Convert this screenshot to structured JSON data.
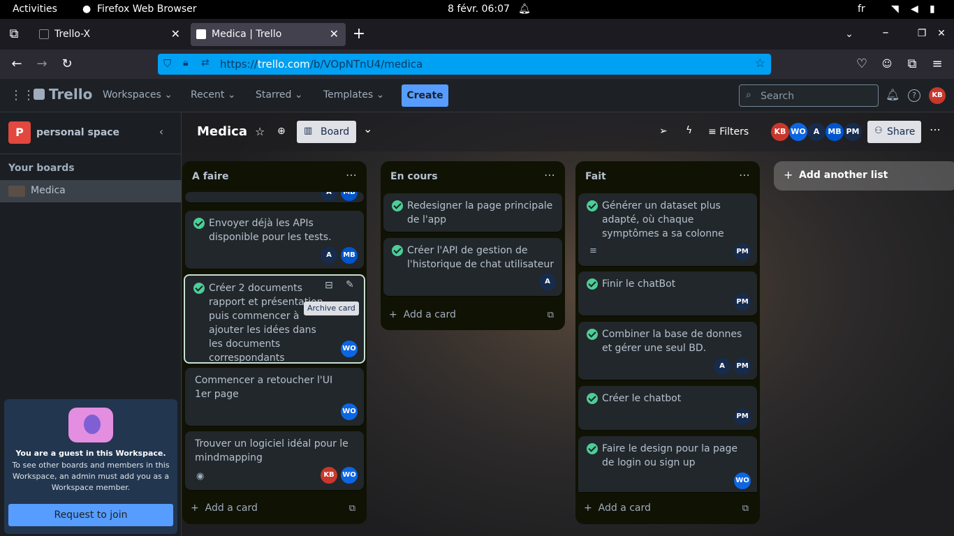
{
  "os": {
    "activities": "Activities",
    "app": "Firefox Web Browser",
    "clock": "8 févr.  06:07",
    "lang": "fr"
  },
  "browser": {
    "tabs": [
      {
        "label": "Trello-X"
      },
      {
        "label": "Medica | Trello"
      }
    ],
    "url_prefix": "https://",
    "url_domain": "trello.com",
    "url_path": "/b/VOpNTnU4/medica"
  },
  "header": {
    "logo": "Trello",
    "menus": [
      "Workspaces",
      "Recent",
      "Starred",
      "Templates"
    ],
    "create": "Create",
    "search_placeholder": "Search",
    "user_initials": "KB"
  },
  "sidebar": {
    "workspace_logo": "P",
    "workspace_name": "personal space",
    "your_boards": "Your boards",
    "boards": [
      "Medica"
    ],
    "guest_title": "You are a guest in this Workspace.",
    "guest_text": "To see other boards and members in this Workspace, an admin must add you as a Workspace member.",
    "request_join": "Request to join"
  },
  "board": {
    "title": "Medica",
    "view": "Board",
    "filters": "Filters",
    "share": "Share",
    "members": [
      "KB",
      "WO",
      "A",
      "MB",
      "PM"
    ],
    "add_list": "Add another list",
    "add_card": "Add a card",
    "tooltip": "Archive card",
    "lists": [
      {
        "title": "A faire",
        "cards": [
          {
            "text": "Envoyer déjà les APIs disponible pour les tests.",
            "members": [
              "A",
              "MB"
            ]
          },
          {
            "text": "Créer 2 documents rapport et présentation puis commencer à ajouter les idées dans les documents correspondants",
            "members": [
              "WO"
            ]
          },
          {
            "text": "Commencer a retoucher l'UI 1er page",
            "members": [
              "WO"
            ]
          },
          {
            "text": "Trouver un logiciel idéal pour le mindmapping",
            "members": [
              "KB",
              "WO"
            ]
          }
        ]
      },
      {
        "title": "En cours",
        "cards": [
          {
            "text": "Redesigner la page principale de l'app",
            "members": []
          },
          {
            "text": "Créer l'API de gestion de l'historique de chat utilisateur",
            "members": [
              "A"
            ]
          }
        ]
      },
      {
        "title": "Fait",
        "cards": [
          {
            "text": "Générer un dataset plus adapté, où chaque symptômes a sa colonne",
            "members": [
              "PM"
            ]
          },
          {
            "text": "Finir le chatBot",
            "members": [
              "PM"
            ]
          },
          {
            "text": "Combiner la base de donnes et gérer une seul BD.",
            "members": [
              "A",
              "PM"
            ]
          },
          {
            "text": "Créer le chatbot",
            "members": [
              "PM"
            ]
          },
          {
            "text": "Faire le design pour la page de login ou sign up",
            "members": [
              "WO"
            ]
          }
        ]
      }
    ]
  }
}
